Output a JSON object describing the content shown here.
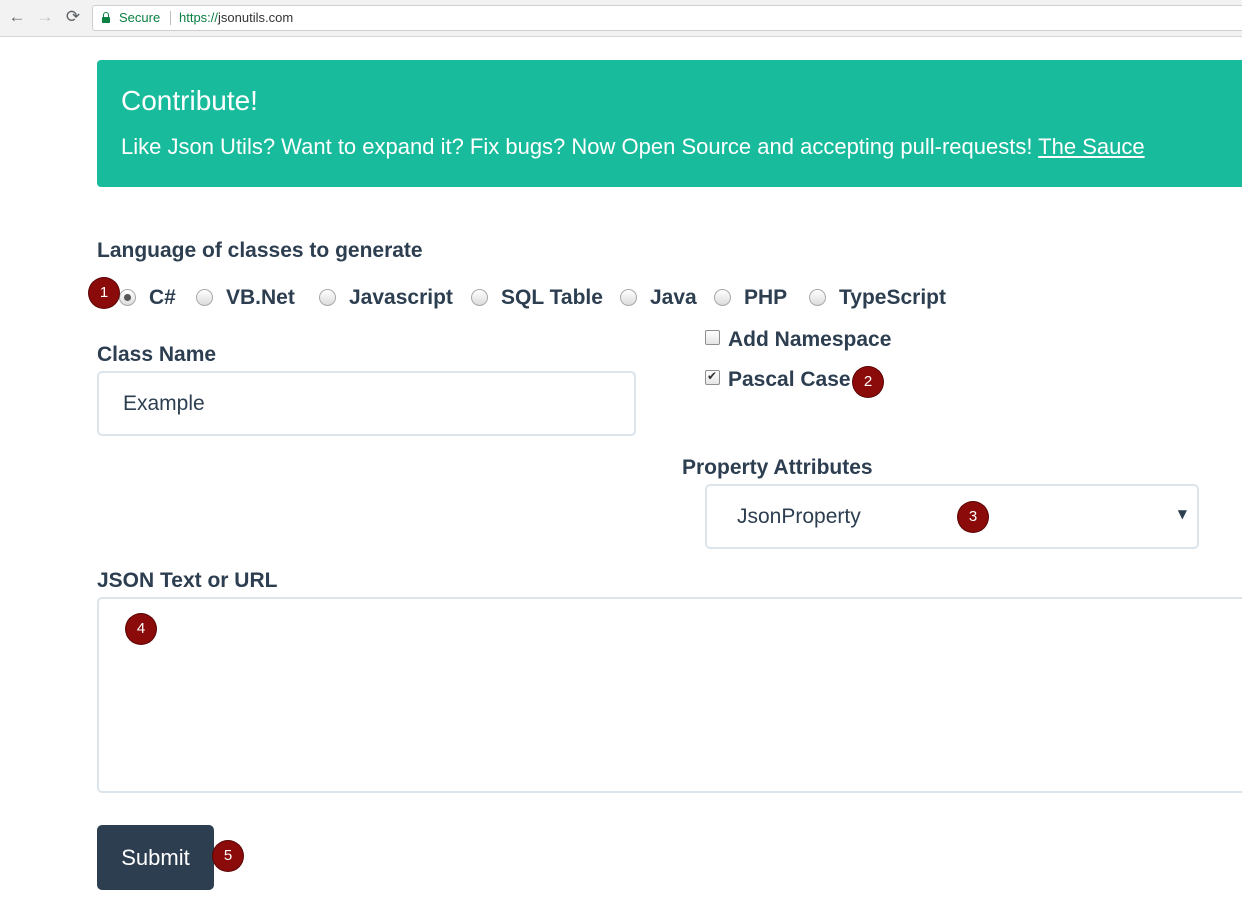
{
  "browser": {
    "back_icon": "←",
    "forward_icon": "→",
    "reload_icon": "⟳",
    "secure_label": "Secure",
    "url_scheme": "https://",
    "url_host": "jsonutils.com"
  },
  "banner": {
    "title": "Contribute!",
    "text": "Like Json Utils? Want to expand it? Fix bugs? Now Open Source and accepting pull-requests!",
    "link": "The Sauce",
    "color": "#18bc9c"
  },
  "language": {
    "label": "Language of classes to generate",
    "selected": "C#",
    "options": [
      "C#",
      "VB.Net",
      "Javascript",
      "SQL Table",
      "Java",
      "PHP",
      "TypeScript"
    ]
  },
  "class_name": {
    "label": "Class Name",
    "value": "Example"
  },
  "options": {
    "add_namespace": {
      "label": "Add Namespace",
      "checked": false
    },
    "pascal_case": {
      "label": "Pascal Case",
      "checked": true
    }
  },
  "property_attributes": {
    "label": "Property Attributes",
    "selected": "JsonProperty",
    "arrow": "▼"
  },
  "json_text": {
    "label": "JSON Text or URL",
    "value": ""
  },
  "submit": {
    "label": "Submit",
    "color": "#2c3e50"
  },
  "markers": [
    "1",
    "2",
    "3",
    "4",
    "5"
  ],
  "marker_color": "#8b0a0a"
}
